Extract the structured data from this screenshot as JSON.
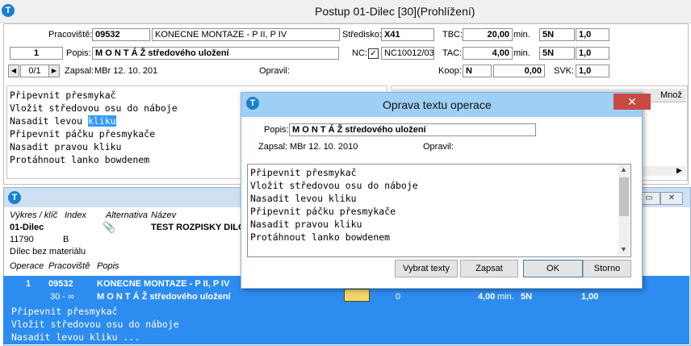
{
  "window": {
    "title": "Postup 01-Dilec   [30](Prohlížení)"
  },
  "form": {
    "pracoviste_label": "Pracoviště:",
    "pracoviste_code": "09532",
    "pracoviste_name": "KONECNE MONTAZE - P II, P IV",
    "stredisko_label": "Středisko:",
    "stredisko_value": "X41",
    "tbc_label": "TBC:",
    "tbc_value": "20,00",
    "tbc_unit": "min.",
    "tbc_code": "5N",
    "tbc_coef": "1,0",
    "seq_value": "1",
    "popis_label": "Popis:",
    "popis_value": "M O N T Á Ž středového uložení",
    "nc_label": "NC:",
    "nc_checked": "✓",
    "nc_value": "NC10012/03",
    "tac_label": "TAC:",
    "tac_value": "4,00",
    "tac_unit": "min.",
    "tac_code": "5N",
    "tac_coef": "1,0",
    "nav_counter": "0/1",
    "zapsal_label": "Zapsal:",
    "zapsal_value": "MBr 12. 10. 201",
    "opravil_label": "Opravil:",
    "koop_label": "Koop:",
    "koop_value": "N",
    "koop_amount": "0,00",
    "svk_label": "SVK:",
    "svk_value": "1,0"
  },
  "text_lines": [
    "Připevnit přesmykač",
    "Vložit středovou osu do náboje",
    "Nasadit levou ",
    "Připevnit páčku přesmykače",
    "Nasadit pravou kliku",
    "Protáhnout lanko bowdenem"
  ],
  "text_selected": "kliku",
  "right_grid": {
    "col_label": "Množ"
  },
  "child": {
    "headers": {
      "vykres": "Výkres / klíč",
      "index": "Index",
      "alternativa": "Alternativa",
      "nazev": "Název"
    },
    "dilec": "01-Dilec",
    "nazev_value": "TEST ROZPISKY DILCE",
    "id_value": "11790",
    "index_value": "B",
    "bez_materialu": "Dílec bez materiálu",
    "op_headers": {
      "operace": "Operace",
      "pracoviste": "Pracoviště",
      "popis": "Popis"
    },
    "row": {
      "seq": "1",
      "code": "09532",
      "name": "KONECNE MONTAZE - P II, P IV",
      "range": "30 - ∞",
      "desc": "M O N T Á Ž středového uložení",
      "zero": "0",
      "time": "4,00",
      "unit": "min.",
      "code2": "5N",
      "coef": "1,00"
    },
    "text_lines": [
      "Připevnit přesmykač",
      "Vložit středovou osu do náboje",
      "Nasadit levou kliku ..."
    ]
  },
  "dialog": {
    "title": "Oprava textu operace",
    "close": "✕",
    "popis_label": "Popis:",
    "popis_value": "M O N T Á Ž středového uložení",
    "zapsal_label": "Zapsal:",
    "zapsal_value": "MBr 12. 10. 2010",
    "opravil_label": "Opravil:",
    "text_lines": [
      "Připevnit přesmykač",
      "Vložit středovou osu do náboje",
      "Nasadit levou kliku",
      "Připevnit páčku přesmykače",
      "Nasadit pravou kliku",
      "Protáhnout lanko bowdenem"
    ],
    "buttons": {
      "vybrat": "Vybrat texty",
      "zapsat": "Zapsat",
      "ok": "OK",
      "storno": "Storno"
    }
  }
}
